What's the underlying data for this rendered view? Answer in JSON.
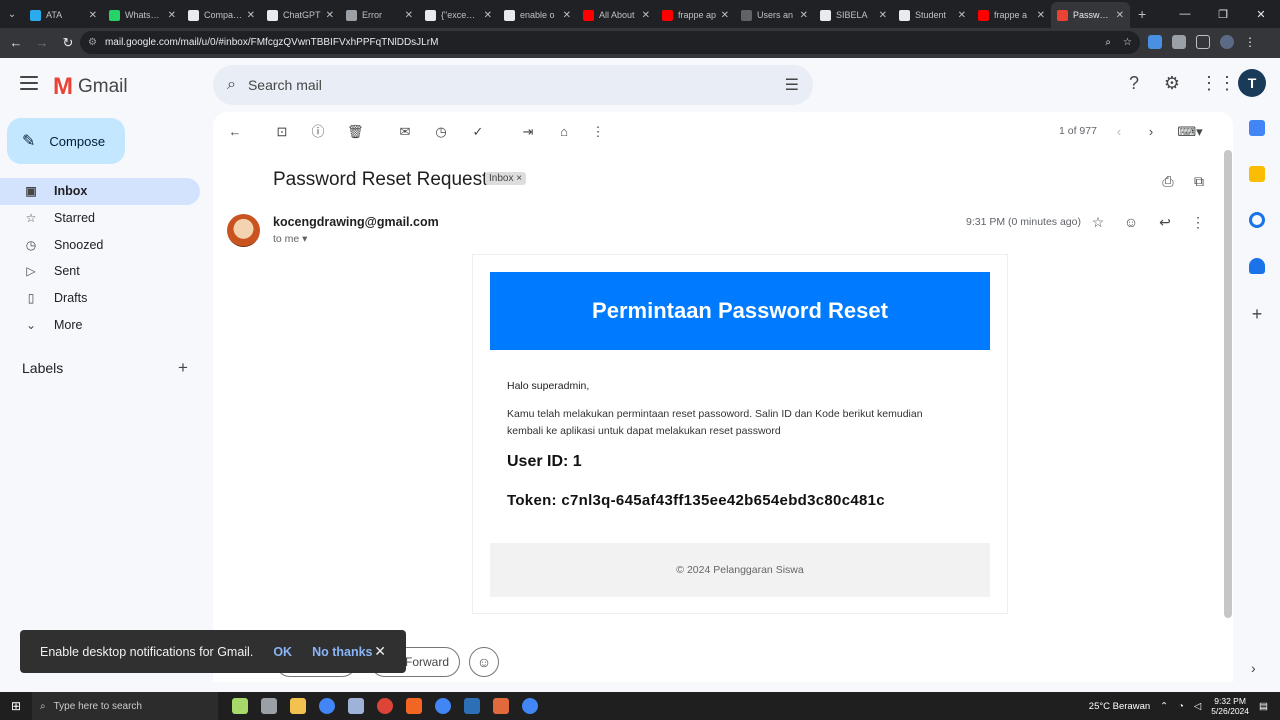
{
  "browser": {
    "tabs": [
      {
        "label": "ATA",
        "color": "#2aabee"
      },
      {
        "label": "WhatsApp",
        "color": "#25d366"
      },
      {
        "label": "Compan...",
        "color": "#e8eaed"
      },
      {
        "label": "ChatGPT",
        "color": "#e8eaed"
      },
      {
        "label": "Error",
        "color": "#9aa0a6"
      },
      {
        "label": "{\"exceptio",
        "color": "#e8eaed"
      },
      {
        "label": "enable o",
        "color": "#e8eaed"
      },
      {
        "label": "All About",
        "color": "#ff0000"
      },
      {
        "label": "frappe ap",
        "color": "#ff0000"
      },
      {
        "label": "Users an",
        "color": "#5f6368"
      },
      {
        "label": "SIBELA",
        "color": "#e8eaed"
      },
      {
        "label": "Student",
        "color": "#e8eaed"
      },
      {
        "label": "frappe a",
        "color": "#ff0000"
      },
      {
        "label": "Passwo...",
        "color": "#ea4335"
      }
    ],
    "url": "mail.google.com/mail/u/0/#inbox/FMfcgzQVwnTBBIFVxhPPFqTNlDDsJLrM"
  },
  "gmail": {
    "brand": "Gmail",
    "search_placeholder": "Search mail",
    "avatar_letter": "T",
    "compose_label": "Compose",
    "nav": [
      {
        "label": "Inbox",
        "icon": "inbox-icon",
        "glyph": "▣"
      },
      {
        "label": "Starred",
        "icon": "star-icon",
        "glyph": "☆"
      },
      {
        "label": "Snoozed",
        "icon": "clock-icon",
        "glyph": "◷"
      },
      {
        "label": "Sent",
        "icon": "send-icon",
        "glyph": "▷"
      },
      {
        "label": "Drafts",
        "icon": "draft-icon",
        "glyph": "▯"
      },
      {
        "label": "More",
        "icon": "chevron-down-icon",
        "glyph": "⌄"
      }
    ],
    "labels_heading": "Labels",
    "pager": "1 of 977"
  },
  "email": {
    "subject": "Password Reset Request",
    "badge": "Inbox ×",
    "sender": "kocengdrawing@gmail.com",
    "to": "to me ▾",
    "time": "9:31 PM (0 minutes ago)",
    "banner": "Permintaan Password Reset",
    "greeting": "Halo superadmin,",
    "paragraph": "Kamu telah melakukan permintaan reset passoword. Salin ID dan Kode berikut kemudian kembali ke aplikasi untuk dapat melakukan reset password",
    "user_id": "User ID: 1",
    "token": "Token: c7nl3q-645af43ff135ee42b654ebd3c80c481c",
    "footer": "© 2024 Pelanggaran Siswa",
    "forward_label": "Forward"
  },
  "toast": {
    "message": "Enable desktop notifications for Gmail.",
    "ok": "OK",
    "no": "No thanks"
  },
  "taskbar": {
    "search_placeholder": "Type here to search",
    "weather": "25°C  Berawan",
    "time": "9:32 PM",
    "date": "5/26/2024"
  }
}
